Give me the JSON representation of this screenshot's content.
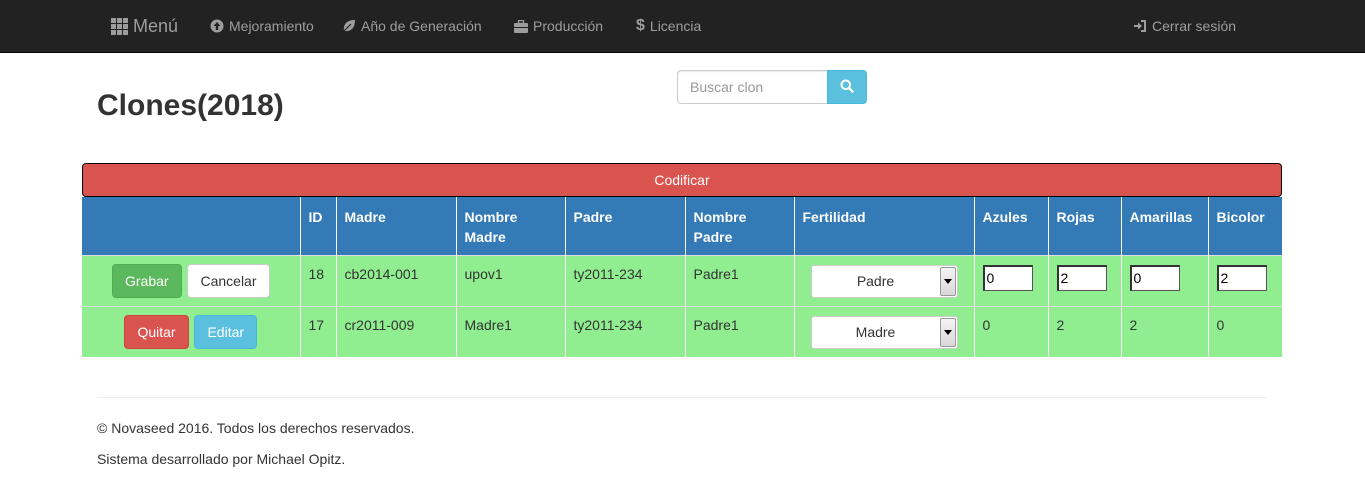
{
  "nav": {
    "brand": "Menú",
    "items": [
      {
        "label": "Mejoramiento",
        "icon": "circle-arrow-up-icon"
      },
      {
        "label": "Año de Generación",
        "icon": "leaf-icon"
      },
      {
        "label": "Producción",
        "icon": "briefcase-icon"
      },
      {
        "label": "Licencia",
        "icon": "dollar-icon"
      }
    ],
    "logout": "Cerrar sesión"
  },
  "page": {
    "title": "Clones(2018)"
  },
  "search": {
    "placeholder": "Buscar clon",
    "icon": "search-icon"
  },
  "codificar_label": "Codificar",
  "table": {
    "headers": [
      "",
      "ID",
      "Madre",
      "Nombre Madre",
      "Padre",
      "Nombre Padre",
      "Fertilidad",
      "Azules",
      "Rojas",
      "Amarillas",
      "Bicolor"
    ],
    "rows": [
      {
        "mode": "edit",
        "buttons": {
          "primary": "Grabar",
          "secondary": "Cancelar"
        },
        "id": "18",
        "madre": "cb2014-001",
        "nombre_madre": "upov1",
        "padre": "ty2011-234",
        "nombre_padre": "Padre1",
        "fertilidad": "Padre",
        "azules": "0",
        "rojas": "2",
        "amarillas": "0",
        "bicolor": "2"
      },
      {
        "mode": "view",
        "buttons": {
          "primary": "Quitar",
          "secondary": "Editar"
        },
        "id": "17",
        "madre": "cr2011-009",
        "nombre_madre": "Madre1",
        "padre": "ty2011-234",
        "nombre_padre": "Padre1",
        "fertilidad": "Madre",
        "azules": "0",
        "rojas": "2",
        "amarillas": "2",
        "bicolor": "0"
      }
    ]
  },
  "footer": {
    "copyright": "© Novaseed 2016. Todos los derechos reservados.",
    "credits": "Sistema desarrollado por Michael Opitz."
  },
  "colors": {
    "navbar": "#222222",
    "header_row": "#337ab7",
    "row_bg": "#90ee90",
    "danger": "#d9534f",
    "success": "#5cb85c",
    "info": "#5bc0de"
  }
}
